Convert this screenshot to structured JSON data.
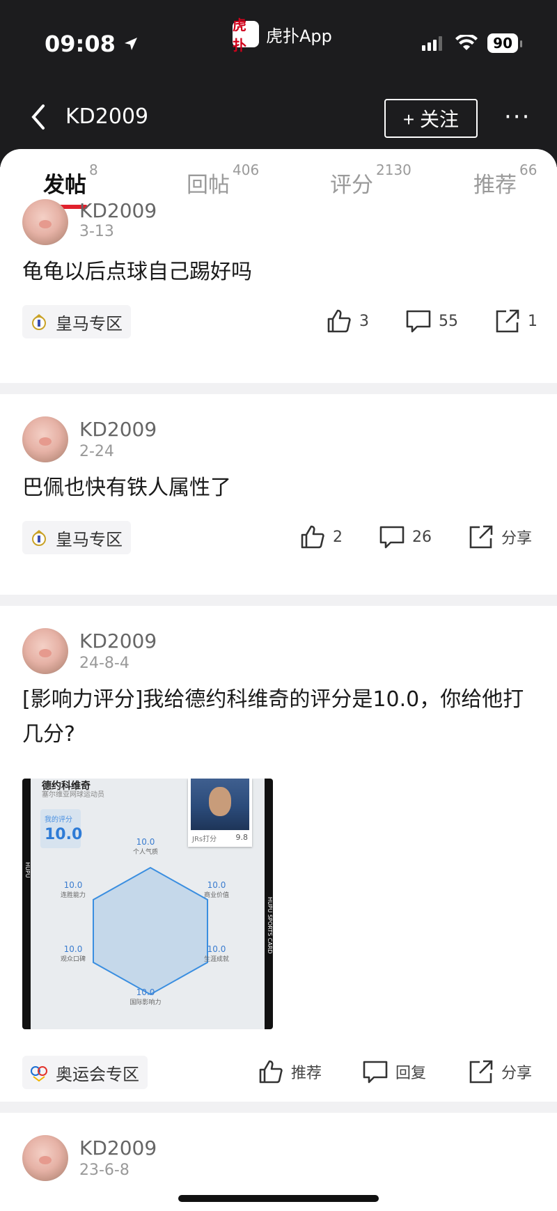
{
  "status_bar": {
    "time": "09:08",
    "app_name": "虎扑App",
    "app_logo_text": "虎扑",
    "battery": "90"
  },
  "nav": {
    "title": "KD2009",
    "follow_label": "+ 关注",
    "more_label": "···"
  },
  "tabs": [
    {
      "label": "发帖",
      "count": "8",
      "active": true
    },
    {
      "label": "回帖",
      "count": "406",
      "active": false
    },
    {
      "label": "评分",
      "count": "2130",
      "active": false
    },
    {
      "label": "推荐",
      "count": "66",
      "active": false
    }
  ],
  "posts": [
    {
      "username": "KD2009",
      "date": "3-13",
      "title": "龟龟以后点球自己踢好吗",
      "zone": "皇马专区",
      "likes": "3",
      "comments": "55",
      "share": "1"
    },
    {
      "username": "KD2009",
      "date": "2-24",
      "title": "巴佩也快有铁人属性了",
      "zone": "皇马专区",
      "likes": "2",
      "comments": "26",
      "share": "分享"
    },
    {
      "username": "KD2009",
      "date": "24-8-4",
      "title": "[影响力评分]我给德约科维奇的评分是10.0，你给他打几分?",
      "zone": "奥运会专区",
      "likes": "推荐",
      "comments": "回复",
      "share": "分享",
      "card": {
        "name": "德约科维奇",
        "subtitle": "塞尔维亚网球运动员",
        "my_score_label": "我的评分",
        "my_score": "10.0",
        "jrs_label": "JRs打分",
        "jrs_score": "9.8",
        "side_left": "HUPU",
        "side_right": "HUPU SPORTS CARD",
        "stats": [
          {
            "value": "10.0",
            "label": "个人气质"
          },
          {
            "value": "10.0",
            "label": "商业价值"
          },
          {
            "value": "10.0",
            "label": "生涯成就"
          },
          {
            "value": "10.0",
            "label": "国际影响力"
          },
          {
            "value": "10.0",
            "label": "观众口碑"
          },
          {
            "value": "10.0",
            "label": "连胜能力"
          }
        ]
      }
    },
    {
      "username": "KD2009",
      "date": "23-6-8"
    }
  ]
}
